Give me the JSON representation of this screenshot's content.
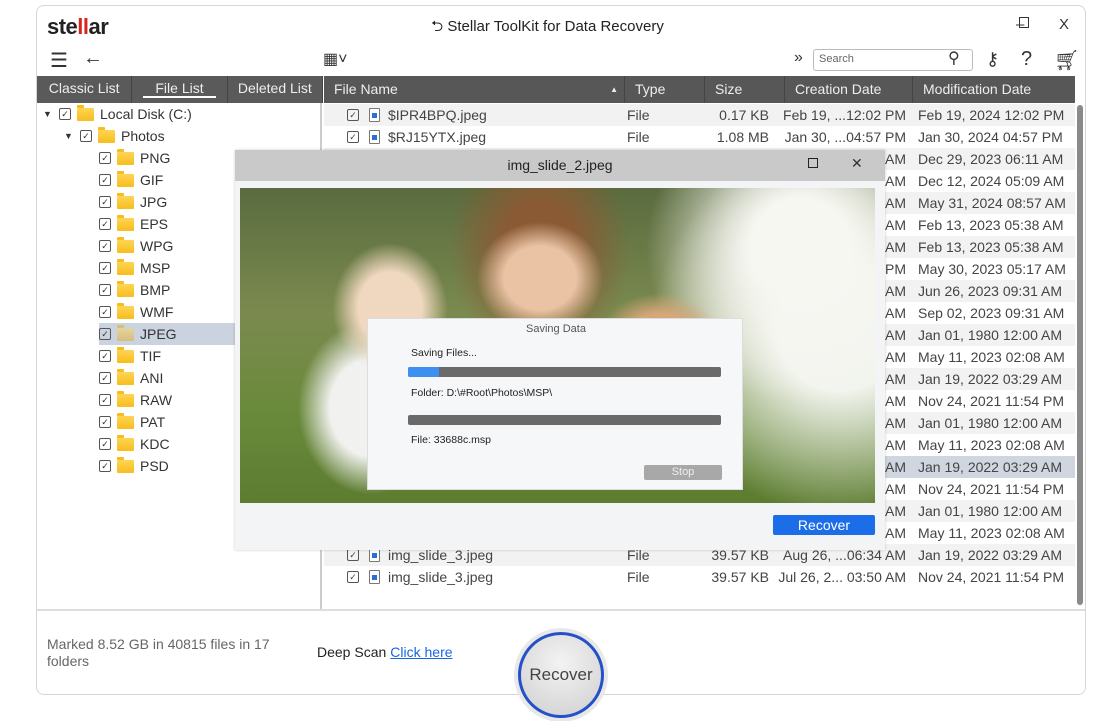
{
  "app": {
    "logo": "stellar",
    "title": "Stellar ToolKit for Data Recovery",
    "minimize": "–",
    "maximize": "☐",
    "close": "X"
  },
  "toolbar": {
    "search_placeholder": "Search",
    "expand": "»"
  },
  "tabs": [
    {
      "label": "Classic List"
    },
    {
      "label": "File List",
      "active": true
    },
    {
      "label": "Deleted List"
    }
  ],
  "tree": {
    "root": "Local Disk (C:)",
    "folder": "Photos",
    "children": [
      "PNG",
      "GIF",
      "JPG",
      "EPS",
      "WPG",
      "MSP",
      "BMP",
      "WMF",
      "JPEG",
      "TIF",
      "ANI",
      "RAW",
      "PAT",
      "KDC",
      "PSD"
    ],
    "selected": "JPEG"
  },
  "columns": [
    "File Name",
    "Type",
    "Size",
    "Creation Date",
    "Modification Date"
  ],
  "rows": [
    {
      "name": "$IPR4BPQ.jpeg",
      "type": "File",
      "size": "0.17 KB",
      "created": "Feb 19, ...12:02 PM",
      "modified": "Feb 19, 2024 12:02 PM"
    },
    {
      "name": "$RJ15YTX.jpeg",
      "type": "File",
      "size": "1.08 MB",
      "created": "Jan 30, ...04:57 PM",
      "modified": "Jan 30, 2024 04:57 PM"
    },
    {
      "created": "AM",
      "modified": "Dec 29, 2023 06:11 AM"
    },
    {
      "created": "AM",
      "modified": "Dec 12, 2024 05:09 AM"
    },
    {
      "created": "AM",
      "modified": "May 31, 2024 08:57 AM"
    },
    {
      "created": "AM",
      "modified": "Feb 13, 2023 05:38 AM"
    },
    {
      "created": "AM",
      "modified": "Feb 13, 2023 05:38 AM"
    },
    {
      "created": "PM",
      "modified": "May 30, 2023 05:17 AM"
    },
    {
      "created": "AM",
      "modified": "Jun 26, 2023 09:31 AM"
    },
    {
      "created": "AM",
      "modified": "Sep 02, 2023 09:31 AM"
    },
    {
      "created": "AM",
      "modified": "Jan 01, 1980 12:00 AM"
    },
    {
      "created": "AM",
      "modified": "May 11, 2023 02:08 AM"
    },
    {
      "created": "AM",
      "modified": "Jan 19, 2022 03:29 AM"
    },
    {
      "created": "AM",
      "modified": "Nov 24, 2021 11:54 PM"
    },
    {
      "created": "AM",
      "modified": "Jan 01, 1980 12:00 AM"
    },
    {
      "created": "AM",
      "modified": "May 11, 2023 02:08 AM"
    },
    {
      "created": "AM",
      "modified": "Jan 19, 2022 03:29 AM",
      "selected": true
    },
    {
      "created": "AM",
      "modified": "Nov 24, 2021 11:54 PM"
    },
    {
      "created": "AM",
      "modified": "Jan 01, 1980 12:00 AM"
    },
    {
      "created": "AM",
      "modified": "May 11, 2023 02:08 AM"
    },
    {
      "name": "img_slide_3.jpeg",
      "type": "File",
      "size": "39.57 KB",
      "created": "Aug 26, ...06:34 AM",
      "modified": "Jan 19, 2022 03:29 AM"
    },
    {
      "name": "img_slide_3.jpeg",
      "type": "File",
      "size": "39.57 KB",
      "created": "Jul 26, 2... 03:50 AM",
      "modified": "Nov 24, 2021 11:54 PM"
    }
  ],
  "preview": {
    "title": "img_slide_2.jpeg",
    "maximize": "☐",
    "close": "✕",
    "recover": "Recover"
  },
  "saving": {
    "title": "Saving Data",
    "status": "Saving Files...",
    "progress_percent": 10,
    "folder": "Folder: D:\\#Root\\Photos\\MSP\\",
    "file_progress_percent": 0,
    "file": "File: 33688c.msp",
    "stop": "Stop"
  },
  "footer": {
    "status": "Marked 8.52 GB in 40815 files in 17 folders",
    "deep_scan": "Deep Scan",
    "click_here": "Click here",
    "recover": "Recover"
  }
}
